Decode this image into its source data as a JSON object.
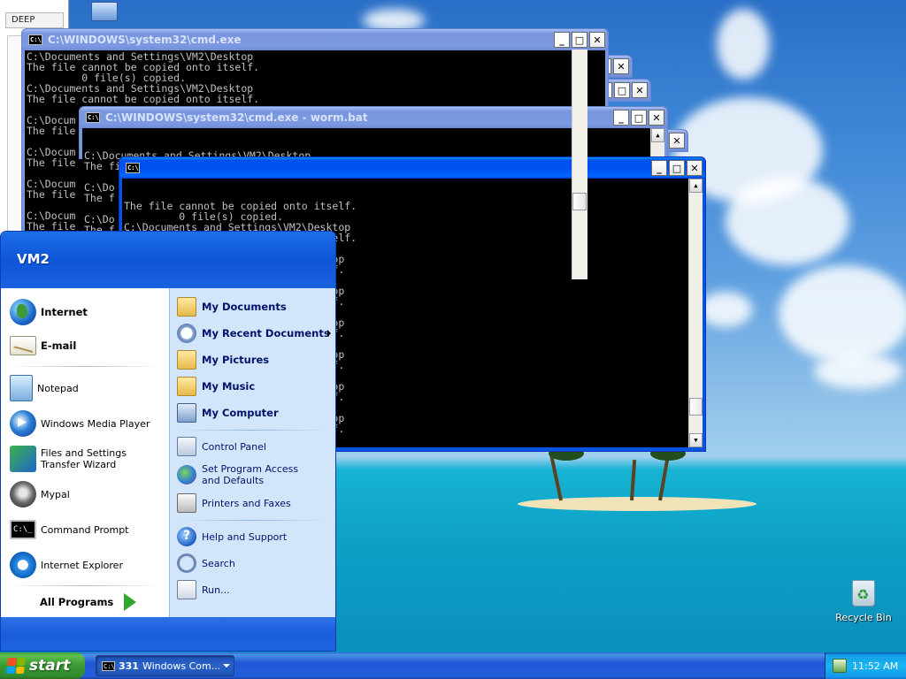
{
  "explorer": {
    "label": "DEEP"
  },
  "windows": {
    "back": {
      "title": "C:\\WINDOWS\\system32\\cmd.exe",
      "lines": [
        "C:\\Documents and Settings\\VM2\\Desktop",
        "The file cannot be copied onto itself.",
        "         0 file(s) copied.",
        "C:\\Documents and Settings\\VM2\\Desktop",
        "The file cannot be copied onto itself.",
        "",
        "C:\\Docum",
        "The file",
        "",
        "C:\\Docum",
        "The file",
        "",
        "C:\\Docum",
        "The file",
        "",
        "C:\\Docum",
        "The file"
      ]
    },
    "mid": {
      "title": "C:\\WINDOWS\\system32\\cmd.exe - worm.bat",
      "lines": [
        "C:\\Documents and Settings\\VM2\\Desktop",
        "The file cannot be copied onto itself.",
        "",
        "C:\\Do",
        "The f",
        "",
        "C:\\Do",
        "The f"
      ]
    },
    "front": {
      "title": "",
      "lines": [
        "The file cannot be copied onto itself.",
        "         0 file(s) copied.",
        "C:\\Documents and Settings\\VM2\\Desktop",
        "The file cannot be copied onto itself.",
        "         0 file(s) copied.",
        "                             Desktop",
        "                             itself.",
        "",
        "                             Desktop",
        "                             itself.",
        "",
        "                             Desktop",
        "                             itself.",
        "",
        "                             Desktop",
        "                             itself.",
        "",
        "                             Desktop",
        "                             itself.",
        "",
        "                             Desktop",
        "                             itself.",
        "",
        "                             Desktop"
      ]
    }
  },
  "start_menu": {
    "user": "VM2",
    "pinned": [
      {
        "label": "Internet",
        "icon": "internet-globe-icon"
      },
      {
        "label": "E-mail",
        "icon": "email-icon"
      }
    ],
    "recent": [
      {
        "label": "Notepad",
        "icon": "notepad-icon"
      },
      {
        "label": "Windows Media Player",
        "icon": "media-player-icon"
      },
      {
        "label": "Files and Settings Transfer Wizard",
        "icon": "transfer-wizard-icon"
      },
      {
        "label": "Mypal",
        "icon": "mypal-icon"
      },
      {
        "label": "Command Prompt",
        "icon": "command-prompt-icon"
      },
      {
        "label": "Internet Explorer",
        "icon": "internet-explorer-icon"
      }
    ],
    "all_programs": "All Programs",
    "right": {
      "my_documents": "My Documents",
      "my_recent_documents": "My Recent Documents",
      "my_pictures": "My Pictures",
      "my_music": "My Music",
      "my_computer": "My Computer",
      "control_panel": "Control Panel",
      "set_program_access": "Set Program Access and Defaults",
      "printers_faxes": "Printers and Faxes",
      "help_support": "Help and Support",
      "search": "Search",
      "run": "Run..."
    }
  },
  "desktop": {
    "recycle_bin": "Recycle Bin"
  },
  "taskbar": {
    "start": "start",
    "button_count": "331",
    "button_label": "Windows Com...",
    "clock": "11:52 AM"
  }
}
